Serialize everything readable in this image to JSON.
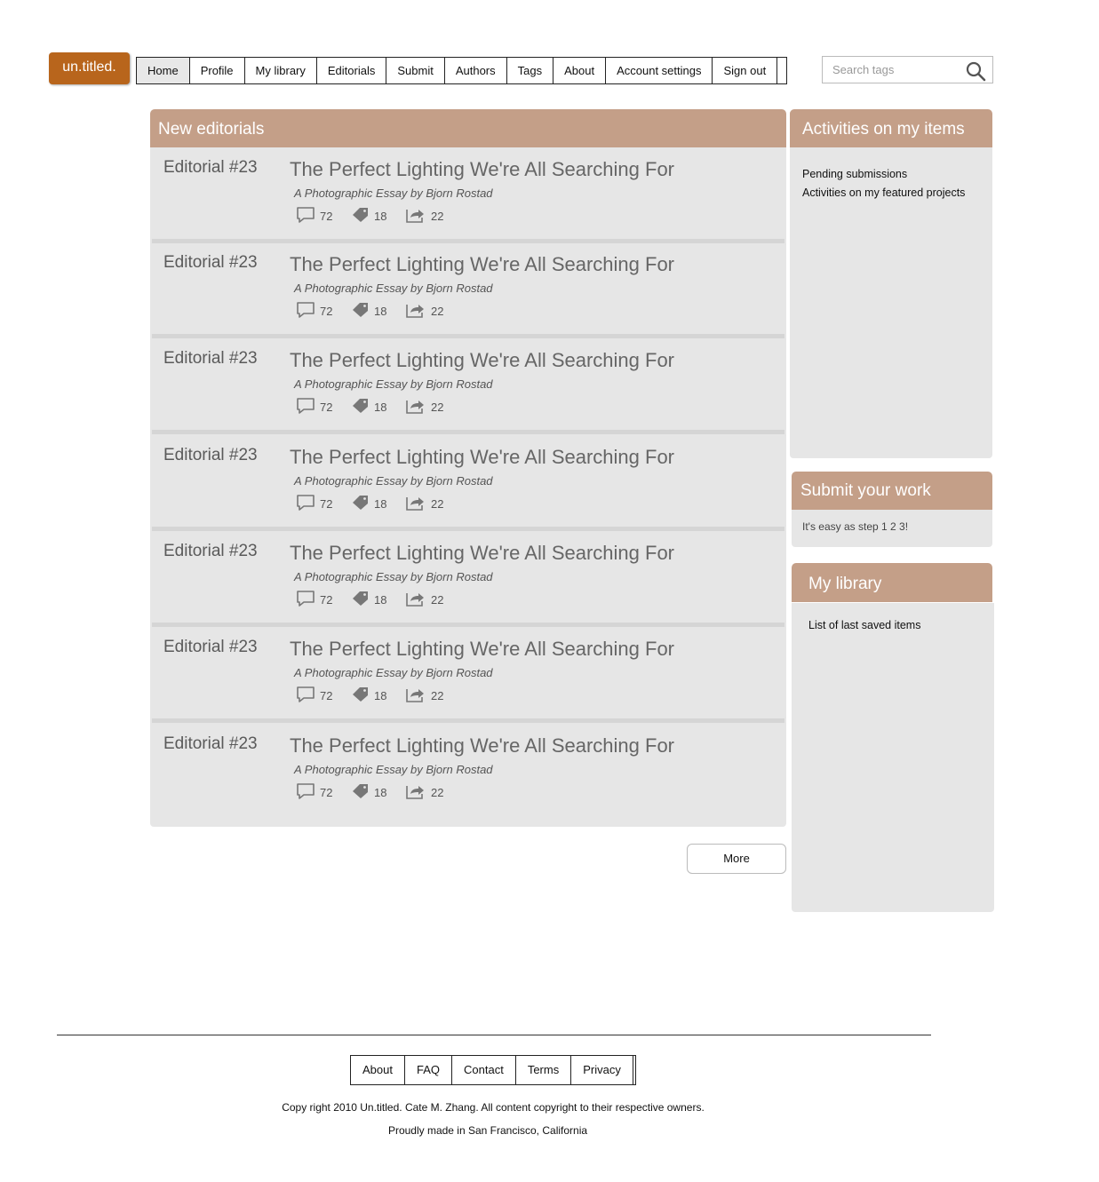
{
  "logo": "un.titled.",
  "nav": [
    "Home",
    "Profile",
    "My library",
    "Editorials",
    "Submit",
    "Authors",
    "Tags",
    "About",
    "Account settings",
    "Sign out"
  ],
  "search": {
    "placeholder": "Search tags"
  },
  "main": {
    "title": "New editorials",
    "entries": [
      {
        "number": "Editorial #23",
        "title": "The Perfect Lighting We're All Searching For",
        "subtitle": "A Photographic Essay by Bjorn Rostad",
        "comments": "72",
        "tags": "18",
        "shares": "22"
      },
      {
        "number": "Editorial #23",
        "title": "The Perfect Lighting We're All Searching For",
        "subtitle": "A Photographic Essay by Bjorn Rostad",
        "comments": "72",
        "tags": "18",
        "shares": "22"
      },
      {
        "number": "Editorial #23",
        "title": "The Perfect Lighting We're All Searching For",
        "subtitle": "A Photographic Essay by Bjorn Rostad",
        "comments": "72",
        "tags": "18",
        "shares": "22"
      },
      {
        "number": "Editorial #23",
        "title": "The Perfect Lighting We're All Searching For",
        "subtitle": "A Photographic Essay by Bjorn Rostad",
        "comments": "72",
        "tags": "18",
        "shares": "22"
      },
      {
        "number": "Editorial #23",
        "title": "The Perfect Lighting We're All Searching For",
        "subtitle": "A Photographic Essay by Bjorn Rostad",
        "comments": "72",
        "tags": "18",
        "shares": "22"
      },
      {
        "number": "Editorial #23",
        "title": "The Perfect Lighting We're All Searching For",
        "subtitle": "A Photographic Essay by Bjorn Rostad",
        "comments": "72",
        "tags": "18",
        "shares": "22"
      },
      {
        "number": "Editorial #23",
        "title": "The Perfect Lighting We're All Searching For",
        "subtitle": "A Photographic Essay by Bjorn Rostad",
        "comments": "72",
        "tags": "18",
        "shares": "22"
      }
    ],
    "more_label": "More"
  },
  "sidebar": {
    "activities": {
      "title": "Activities on my items",
      "links": [
        "Pending submissions",
        "Activities on my featured projects"
      ]
    },
    "submit": {
      "title": "Submit your work",
      "text": "It's easy as step 1 2 3!"
    },
    "library": {
      "title": "My library",
      "text": "List of last saved items"
    }
  },
  "footer": {
    "links": [
      "About",
      "FAQ",
      "Contact",
      "Terms",
      "Privacy"
    ],
    "copyright": "Copy right 2010 Un.titled. Cate M. Zhang. All content copyright to their respective owners.",
    "made_in": "Proudly made in San Francisco, California"
  },
  "colors": {
    "brand": "#b8651c",
    "panel_header": "#c49f88",
    "panel_body": "#e6e6e6"
  },
  "icons": {
    "search": "magnifier-icon",
    "comments": "speech-bubble-icon",
    "tags": "tag-icon",
    "shares": "share-arrow-icon"
  }
}
